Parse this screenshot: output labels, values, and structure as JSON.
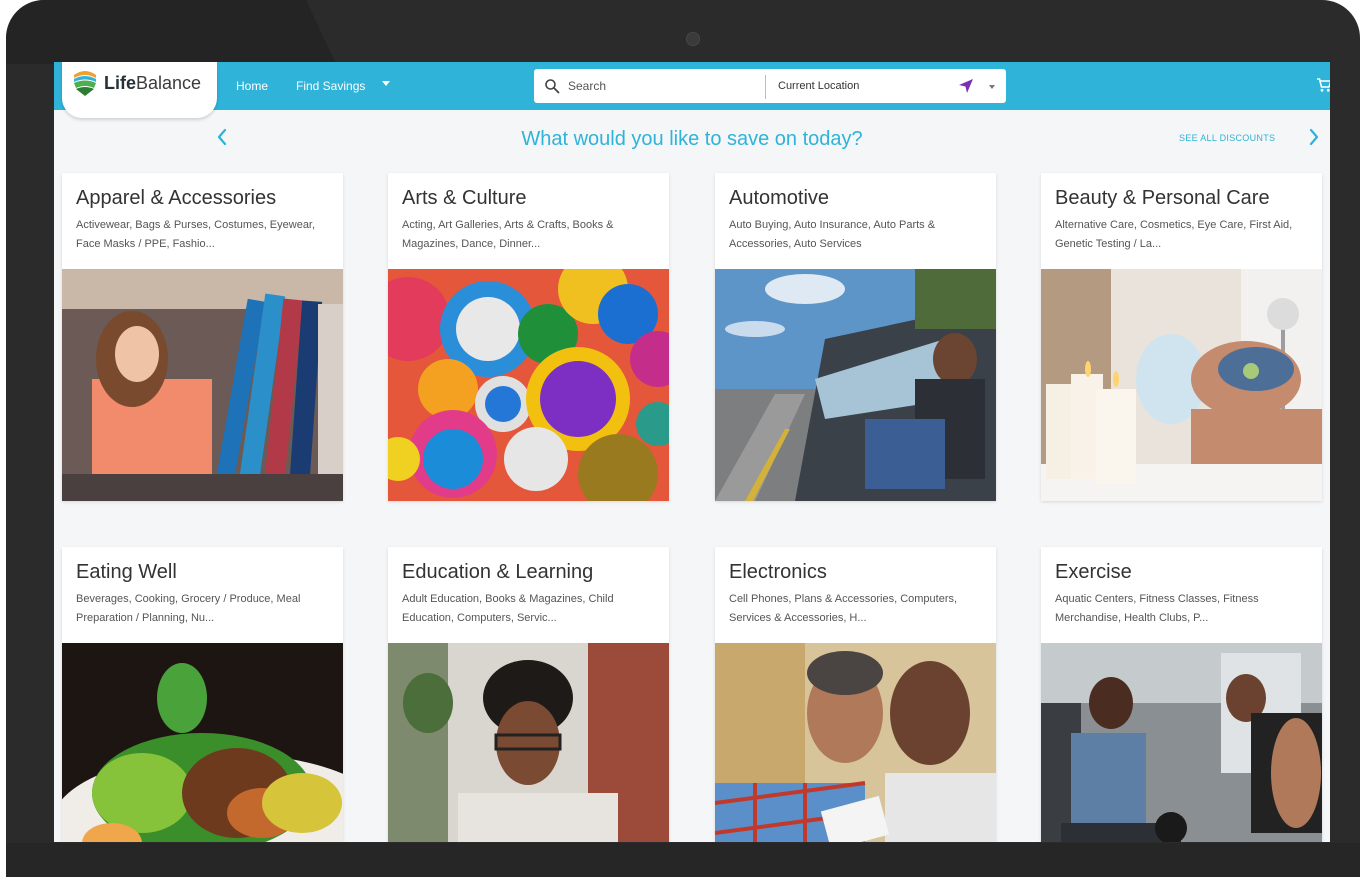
{
  "brand": {
    "name_bold": "Life",
    "name_regular": "Balance"
  },
  "nav": {
    "links": [
      {
        "label": "Home"
      },
      {
        "label": "Find Savings"
      }
    ]
  },
  "search": {
    "placeholder": "Search",
    "location": "Current Location"
  },
  "heading": {
    "title": "What would you like to save on today?",
    "see_all": "SEE ALL DISCOUNTS"
  },
  "icons": {
    "logo": "lifebalance-logo-icon",
    "search": "search-icon",
    "locate": "location-arrow-icon",
    "cart": "cart-icon",
    "prev": "chevron-left-icon",
    "next": "chevron-right-icon"
  },
  "colors": {
    "accent": "#2fb3d9",
    "locate_icon": "#7b2fb3"
  },
  "categories": [
    {
      "title": "Apparel & Accessories",
      "desc": "Activewear, Bags & Purses, Costumes, Eyewear, Face Masks / PPE, Fashio..."
    },
    {
      "title": "Arts & Culture",
      "desc": "Acting, Art Galleries, Arts & Crafts, Books & Magazines, Dance, Dinner..."
    },
    {
      "title": "Automotive",
      "desc": "Auto Buying, Auto Insurance, Auto Parts & Accessories, Auto Services"
    },
    {
      "title": "Beauty & Personal Care",
      "desc": "Alternative Care, Cosmetics, Eye Care, First Aid, Genetic Testing / La..."
    },
    {
      "title": "Eating Well",
      "desc": "Beverages, Cooking, Grocery / Produce, Meal Preparation / Planning, Nu..."
    },
    {
      "title": "Education & Learning",
      "desc": "Adult Education, Books & Magazines, Child Education, Computers, Servic..."
    },
    {
      "title": "Electronics",
      "desc": "Cell Phones, Plans & Accessories, Computers, Services & Accessories, H..."
    },
    {
      "title": "Exercise",
      "desc": "Aquatic Centers, Fitness Classes, Fitness Merchandise, Health Clubs, P..."
    }
  ]
}
